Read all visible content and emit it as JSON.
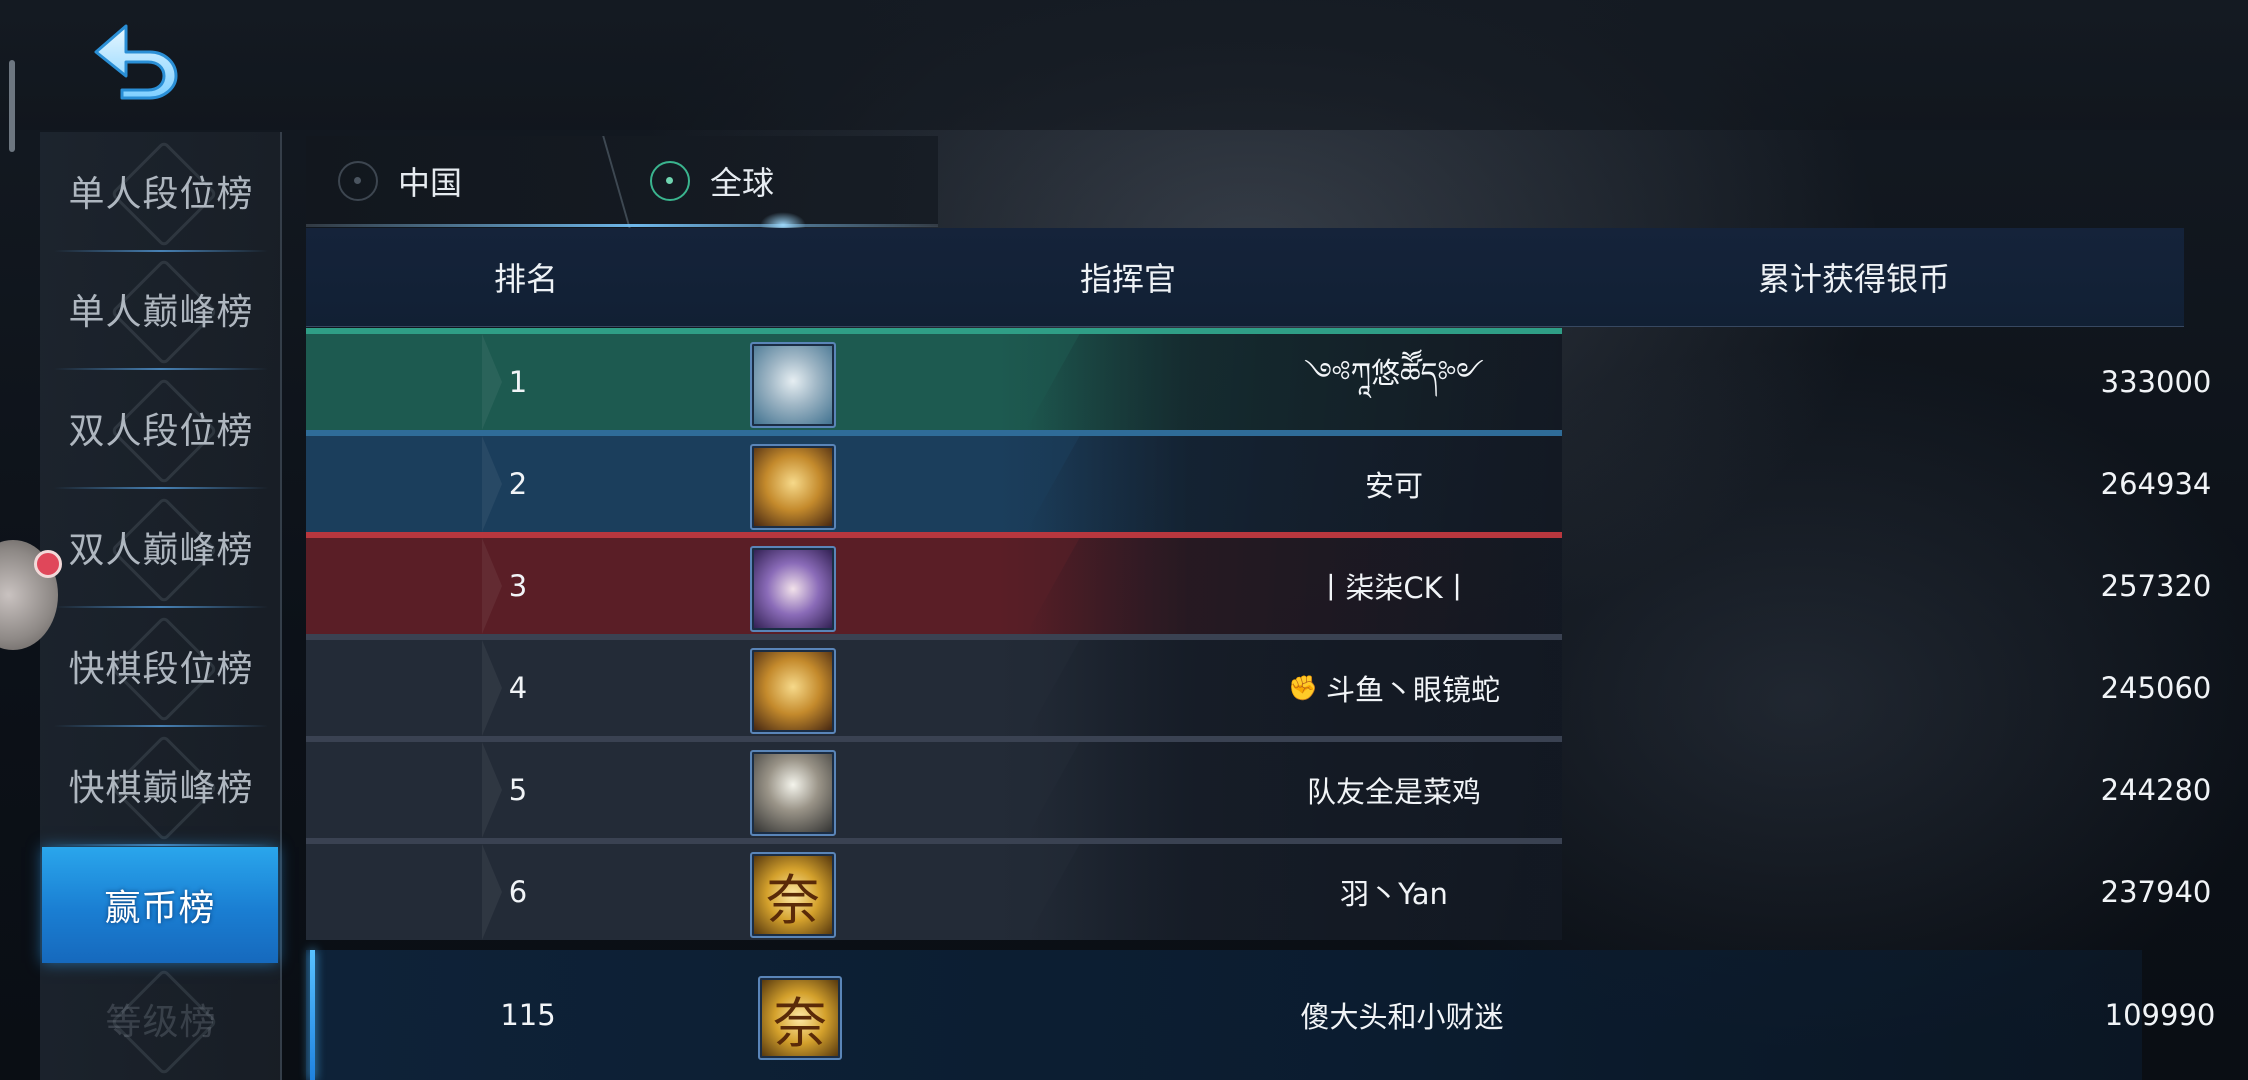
{
  "window": {
    "width": 2248,
    "height": 1080
  },
  "colors": {
    "accent_blue": "#1f8fe0",
    "radio_on": "#3ab48e"
  },
  "nav": {
    "back_icon": "back-arrow-icon",
    "items": [
      {
        "label": "单人段位榜"
      },
      {
        "label": "单人巅峰榜"
      },
      {
        "label": "双人段位榜"
      },
      {
        "label": "双人巅峰榜"
      },
      {
        "label": "快棋段位榜"
      },
      {
        "label": "快棋巅峰榜"
      },
      {
        "label": "赢币榜",
        "active": true
      },
      {
        "label": "等级榜"
      }
    ]
  },
  "region_tabs": [
    {
      "label": "中国",
      "selected": false
    },
    {
      "label": "全球",
      "selected": true
    }
  ],
  "table": {
    "columns": [
      "排名",
      "指挥官",
      "累计获得银币"
    ],
    "rows": [
      {
        "rank": "1",
        "name": "༺ཀཱ悠ཚཽད༻",
        "coins": "333000",
        "bar": "#2f9e86",
        "tint": "#1d5a50",
        "avatar": "av-teal"
      },
      {
        "rank": "2",
        "name": "安可",
        "coins": "264934",
        "bar": "#2f6c98",
        "tint": "#1b3e5c",
        "avatar": "av-gold"
      },
      {
        "rank": "3",
        "name": "丨柒柒CK丨",
        "coins": "257320",
        "bar": "#b8373e",
        "tint": "#5a1e26",
        "avatar": "av-purple"
      },
      {
        "rank": "4",
        "name": "斗鱼丶眼镜蛇",
        "coins": "245060",
        "bar": "#3a4252",
        "tint": "#232b37",
        "avatar": "av-gold",
        "name_icon": "fist-icon"
      },
      {
        "rank": "5",
        "name": "队友全是菜鸡",
        "coins": "244280",
        "bar": "#3a4252",
        "tint": "#232b37",
        "avatar": "av-orb"
      },
      {
        "rank": "6",
        "name": "羽丶Yan",
        "coins": "237940",
        "bar": "#3a4252",
        "tint": "#232b37",
        "avatar": "av-seal"
      }
    ]
  },
  "my_rank": {
    "rank": "115",
    "name": "傻大头和小财迷",
    "coins": "109990",
    "avatar": "av-seal"
  }
}
